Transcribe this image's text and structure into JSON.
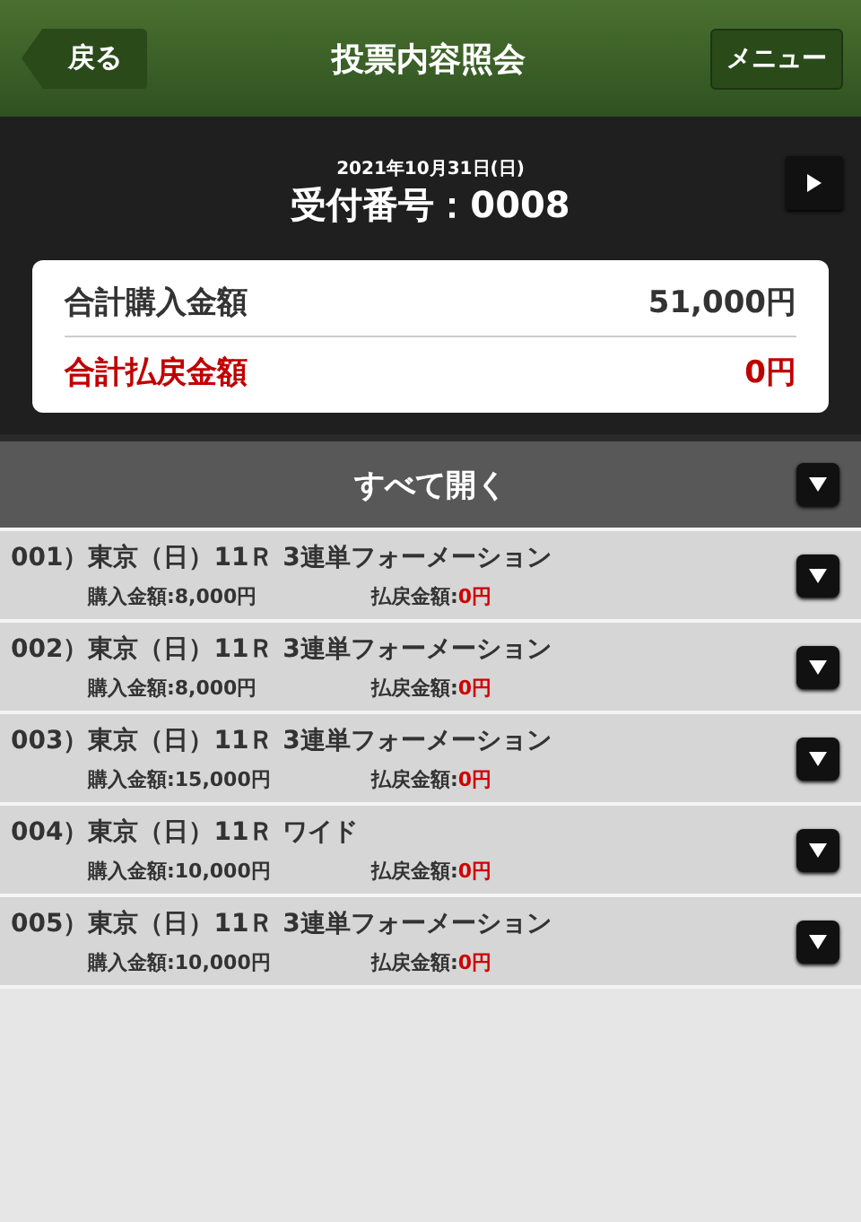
{
  "header": {
    "back": "戻る",
    "title": "投票内容照会",
    "menu": "メニュー"
  },
  "receipt": {
    "date": "2021年10月31日(日)",
    "number": "受付番号：0008"
  },
  "summary": {
    "purchase_label": "合計購入金額",
    "purchase_value": "51,000円",
    "payout_label": "合計払戻金額",
    "payout_value": "0円"
  },
  "expand_all": {
    "label": "すべて開く"
  },
  "bets": [
    {
      "title": "001）東京（日）11Ｒ 3連単フォーメーション",
      "purchase": "購入金額:8,000円",
      "payout_label": "払戻金額:",
      "payout_value": "0円",
      "expanded": false
    },
    {
      "title": "002）東京（日）11Ｒ 3連単フォーメーション",
      "purchase": "購入金額:8,000円",
      "payout_label": "払戻金額:",
      "payout_value": "0円",
      "expanded": false
    },
    {
      "title": "003）東京（日）11Ｒ 3連単フォーメーション",
      "purchase": "購入金額:15,000円",
      "payout_label": "払戻金額:",
      "payout_value": "0円",
      "expanded": false
    },
    {
      "title": "004）東京（日）11Ｒ ワイド",
      "purchase": "購入金額:10,000円",
      "payout_label": "払戻金額:",
      "payout_value": "0円",
      "expanded": false
    },
    {
      "title": "005）東京（日）11Ｒ 3連単フォーメーション",
      "purchase": "購入金額:10,000円",
      "payout_label": "払戻金額:",
      "payout_value": "0円",
      "expanded": false
    }
  ]
}
